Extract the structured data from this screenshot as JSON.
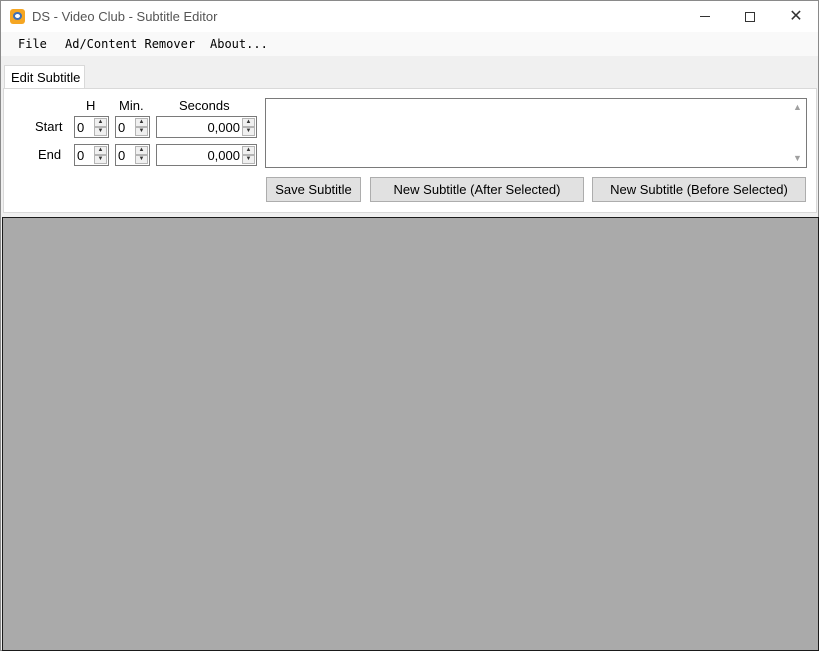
{
  "window": {
    "title": "DS - Video Club - Subtitle Editor",
    "controls": {
      "minimize": "minimize",
      "maximize": "maximize",
      "close": "✕"
    }
  },
  "menu": {
    "items": [
      "File",
      "Ad/Content Remover",
      "About..."
    ]
  },
  "tabs": [
    {
      "label": "Edit Subtitle",
      "active": true
    }
  ],
  "editor": {
    "headers": {
      "hours": "H",
      "minutes": "Min.",
      "seconds": "Seconds"
    },
    "start": {
      "label": "Start",
      "hours": "0",
      "minutes": "0",
      "seconds": "0,000"
    },
    "end": {
      "label": "End",
      "hours": "0",
      "minutes": "0",
      "seconds": "0,000"
    },
    "subtitle_text": ""
  },
  "buttons": {
    "save": "Save Subtitle",
    "new_after": "New Subtitle (After Selected)",
    "new_before": "New Subtitle (Before Selected)"
  },
  "colors": {
    "video_area": "#aaaaaa",
    "app_icon": "#f5a623"
  }
}
